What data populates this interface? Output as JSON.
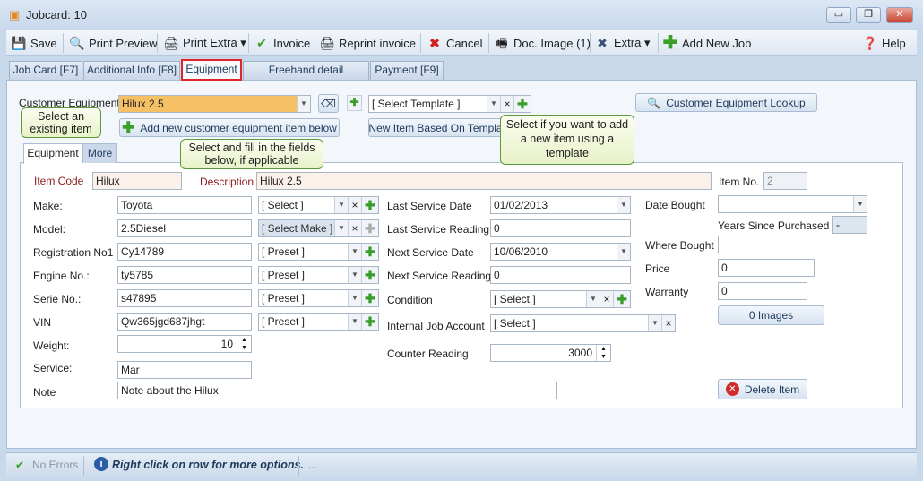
{
  "window": {
    "title": "Jobcard: 10",
    "minimize": "▭",
    "restore": "❐",
    "close": "✕"
  },
  "toolbar": {
    "save": "Save",
    "print_preview": "Print Preview",
    "print_extra": "Print Extra ▾",
    "invoice": "Invoice",
    "reprint_invoice": "Reprint invoice",
    "cancel": "Cancel",
    "doc_image": "Doc. Image (1)",
    "extra": "Extra ▾",
    "add_new_job": "Add New Job",
    "help": "Help"
  },
  "tabs": [
    "Job Card [F7]",
    "Additional Info [F8]",
    "Equipment",
    "Freehand detail description",
    "Payment [F9]"
  ],
  "top": {
    "customer_equipment_label": "Customer Equipment",
    "customer_equipment_value": "Hilux 2.5",
    "template_value": "[ Select Template ]",
    "lookup_button": "Customer Equipment Lookup",
    "add_new_button": "Add new customer equipment item below",
    "new_from_template_button": "New Item Based On Template"
  },
  "callouts": {
    "existing": "Select an existing item",
    "fill": "Select and fill in the fields below, if applicable",
    "template": "Select if you want to add a new item using a template"
  },
  "inner_tabs": [
    "Equipment",
    "More"
  ],
  "form": {
    "item_code_label": "Item Code",
    "item_code": "Hilux",
    "description_label": "Description",
    "description": "Hilux 2.5",
    "item_no_label": "Item No.",
    "item_no": "2",
    "left": [
      {
        "label": "Make:",
        "value": "Toyota",
        "combo": "[ Select ]"
      },
      {
        "label": "Model:",
        "value": "2.5Diesel",
        "combo": "[ Select Make ]"
      },
      {
        "label": "Registration No1",
        "value": "Cy14789",
        "combo": "[ Preset ]"
      },
      {
        "label": "Engine No.:",
        "value": "ty5785",
        "combo": "[ Preset ]"
      },
      {
        "label": "Serie No.:",
        "value": "s47895",
        "combo": "[ Preset ]"
      },
      {
        "label": "VIN",
        "value": "Qw365jgd687jhgt",
        "combo": "[ Preset ]"
      }
    ],
    "weight_label": "Weight:",
    "weight": "10",
    "service_label": "Service:",
    "service": "Mar",
    "note_label": "Note",
    "note": "Note about the Hilux",
    "last_service_date_label": "Last Service Date",
    "last_service_date": "01/02/2013",
    "last_service_reading_label": "Last Service Reading",
    "last_service_reading": "0",
    "next_service_date_label": "Next Service Date",
    "next_service_date": "10/06/2010",
    "next_service_reading_label": "Next Service Reading",
    "next_service_reading": "0",
    "condition_label": "Condition",
    "condition": "[ Select ]",
    "internal_job_account_label": "Internal Job Account",
    "internal_job_account": "[ Select ]",
    "counter_reading_label": "Counter Reading",
    "counter_reading": "3000",
    "date_bought_label": "Date Bought",
    "date_bought": "",
    "years_since_label": "Years Since Purchased",
    "years_since": "-",
    "where_bought_label": "Where Bought",
    "where_bought": "",
    "price_label": "Price",
    "price": "0",
    "warranty_label": "Warranty",
    "warranty": "0",
    "images_button": "0 Images",
    "delete_button": "Delete Item"
  },
  "status": {
    "errors": "No Errors",
    "hint": "Right click on row for more options.",
    "more": "..."
  },
  "colors": {
    "accent_orange": "#f6c064",
    "active_tab_border": "#e0242a"
  }
}
